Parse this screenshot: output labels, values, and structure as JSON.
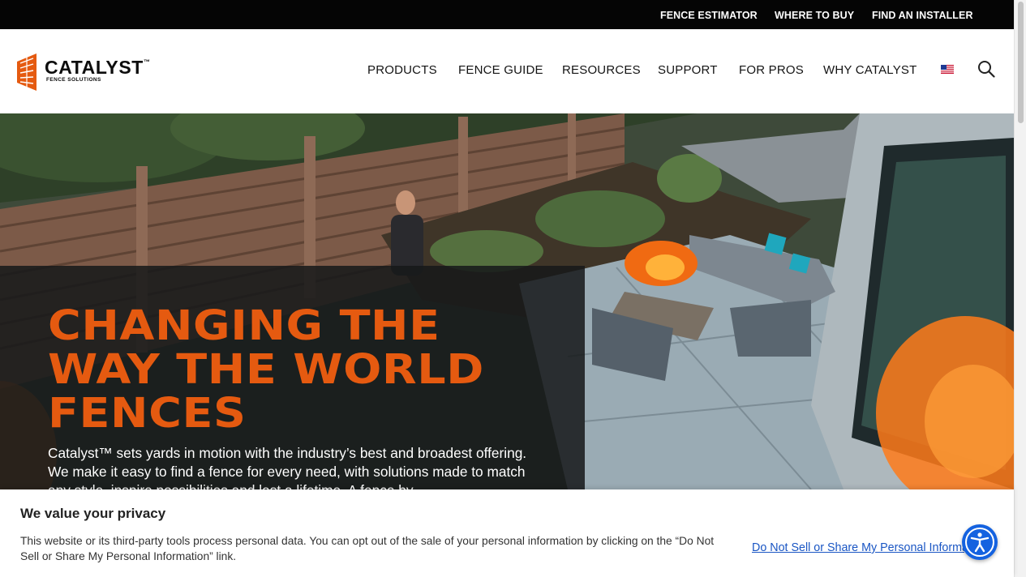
{
  "topbar": {
    "links": [
      {
        "label": "FENCE ESTIMATOR"
      },
      {
        "label": "WHERE TO BUY"
      },
      {
        "label": "FIND AN INSTALLER"
      }
    ]
  },
  "header": {
    "logo": {
      "name": "CATALYST",
      "trademark": "™",
      "tagline": "FENCE SOLUTIONS"
    },
    "nav": [
      {
        "label": "PRODUCTS"
      },
      {
        "label": "FENCE GUIDE"
      },
      {
        "label": "RESOURCES"
      },
      {
        "label": "SUPPORT"
      },
      {
        "label": "FOR PROS"
      },
      {
        "label": "WHY CATALYST"
      }
    ],
    "flag_icon": "us-flag-icon",
    "search_icon": "search-icon"
  },
  "hero": {
    "title_lines": [
      "CHANGING THE",
      "WAY THE WORLD",
      "FENCES"
    ],
    "body": "Catalyst™ sets yards in motion with the industry’s best and broadest offering. We make it easy to find a fence for every need, with solutions made to match any style, inspire possibilities and last a lifetime. A fence by"
  },
  "privacy_banner": {
    "title": "We value your privacy",
    "text": "This website or its third-party tools process personal data. You can opt out of the sale of your personal information by clicking on the “Do Not Sell or Share My Personal Information” link.",
    "link": "Do Not Sell or Share My Personal Information"
  },
  "accessibility_button": {
    "icon": "accessibility-icon"
  },
  "colors": {
    "brand_orange": "#e55a10",
    "topbar_bg": "#050505",
    "link_blue": "#1a56c4",
    "a11y_blue": "#1462e0"
  }
}
